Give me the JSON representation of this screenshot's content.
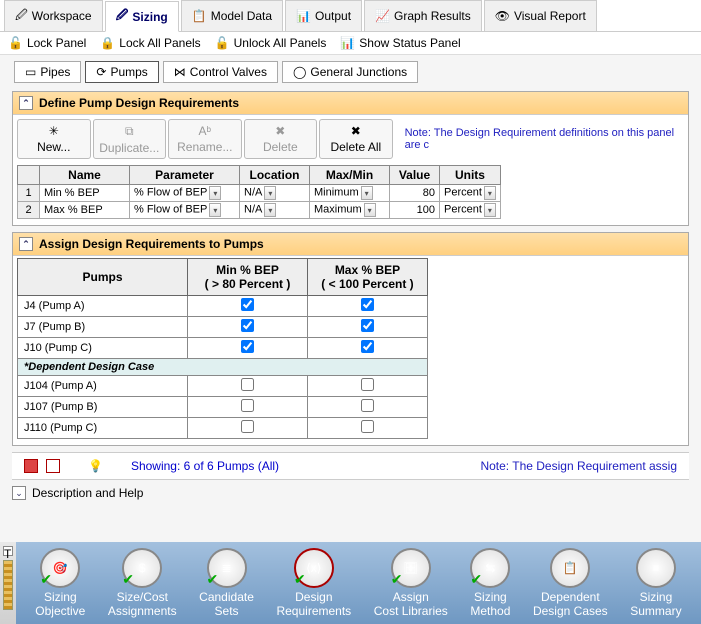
{
  "topTabs": [
    "Workspace",
    "Sizing",
    "Model Data",
    "Output",
    "Graph Results",
    "Visual Report"
  ],
  "activeTopTab": 1,
  "lockBar": {
    "lock": "Lock Panel",
    "lockAll": "Lock All Panels",
    "unlockAll": "Unlock All Panels",
    "status": "Show Status Panel"
  },
  "subTabs": [
    "Pipes",
    "Pumps",
    "Control Valves",
    "General Junctions"
  ],
  "activeSubTab": 1,
  "definePanel": {
    "title": "Define Pump Design Requirements",
    "buttons": {
      "new": "New...",
      "dup": "Duplicate...",
      "ren": "Rename...",
      "del": "Delete",
      "delAll": "Delete All"
    },
    "note": "Note: The Design Requirement definitions on this panel are c",
    "headers": [
      "Name",
      "Parameter",
      "Location",
      "Max/Min",
      "Value",
      "Units"
    ],
    "rows": [
      {
        "n": "1",
        "name": "Min % BEP",
        "param": "% Flow of BEP",
        "loc": "N/A",
        "mm": "Minimum",
        "val": "80",
        "units": "Percent"
      },
      {
        "n": "2",
        "name": "Max % BEP",
        "param": "% Flow of BEP",
        "loc": "N/A",
        "mm": "Maximum",
        "val": "100",
        "units": "Percent"
      }
    ]
  },
  "assignPanel": {
    "title": "Assign Design Requirements to Pumps",
    "colPump": "Pumps",
    "colMin": "Min % BEP\n( > 80 Percent )",
    "colMax": "Max % BEP\n( < 100 Percent )",
    "depLabel": "*Dependent Design Case",
    "rows": [
      {
        "label": "J4 (Pump A)",
        "min": true,
        "max": true
      },
      {
        "label": "J7 (Pump B)",
        "min": true,
        "max": true
      },
      {
        "label": "J10 (Pump C)",
        "min": true,
        "max": true
      }
    ],
    "depRows": [
      {
        "label": "J104 (Pump A)",
        "min": false,
        "max": false
      },
      {
        "label": "J107 (Pump B)",
        "min": false,
        "max": false
      },
      {
        "label": "J110 (Pump C)",
        "min": false,
        "max": false
      }
    ]
  },
  "statusLine": {
    "showing": "Showing: 6 of 6 Pumps (All)",
    "note": "Note: The Design Requirement assig"
  },
  "descHelp": "Description and Help",
  "bottomNav": [
    {
      "label": "Sizing\nObjective",
      "icon": "🎯",
      "check": true
    },
    {
      "label": "Size/Cost\nAssignments",
      "icon": "$",
      "check": true
    },
    {
      "label": "Candidate\nSets",
      "icon": "≣",
      "check": true
    },
    {
      "label": "Design\nRequirements",
      "icon": "⟨x⟩",
      "check": true,
      "active": true
    },
    {
      "label": "Assign\nCost Libraries",
      "icon": "🗄",
      "check": true
    },
    {
      "label": "Sizing\nMethod",
      "icon": "⇆",
      "check": true
    },
    {
      "label": "Dependent\nDesign Cases",
      "icon": "📋",
      "check": false
    },
    {
      "label": "Sizing\nSummary",
      "icon": "≡",
      "check": false
    }
  ]
}
